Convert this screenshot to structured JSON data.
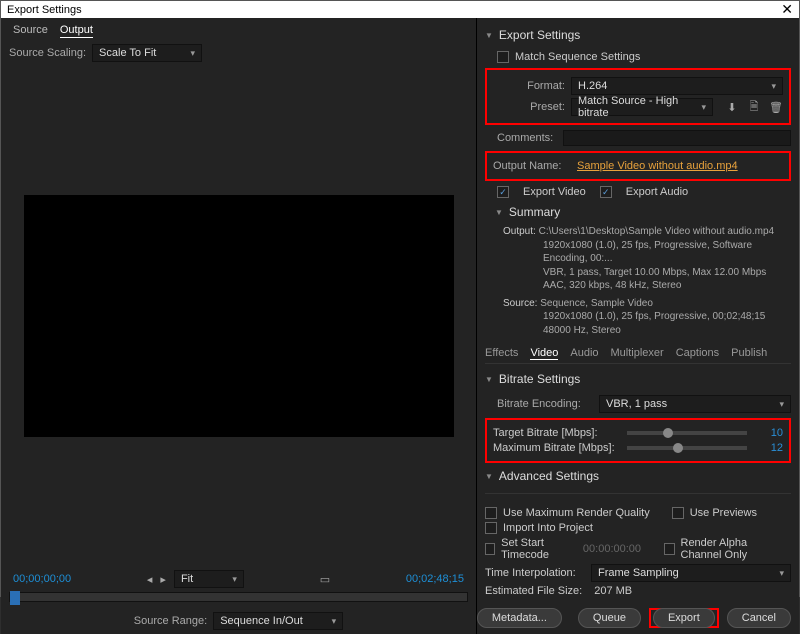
{
  "window": {
    "title": "Export Settings"
  },
  "left": {
    "tabs": {
      "source": "Source",
      "output": "Output"
    },
    "sourceScaling": {
      "label": "Source Scaling:",
      "value": "Scale To Fit"
    },
    "timeStart": "00;00;00;00",
    "timeEnd": "00;02;48;15",
    "fit": "Fit",
    "sourceRange": {
      "label": "Source Range:",
      "value": "Sequence In/Out"
    }
  },
  "right": {
    "headerExport": "Export Settings",
    "matchSequence": "Match Sequence Settings",
    "format": {
      "label": "Format:",
      "value": "H.264"
    },
    "preset": {
      "label": "Preset:",
      "value": "Match Source - High bitrate"
    },
    "comments": "Comments:",
    "outputName": {
      "label": "Output Name:",
      "value": "Sample  Video without audio.mp4"
    },
    "exportVideo": "Export Video",
    "exportAudio": "Export Audio",
    "summaryHeader": "Summary",
    "summary": {
      "outputLabel": "Output:",
      "output1": "C:\\Users\\1\\Desktop\\Sample  Video without audio.mp4",
      "output2": "1920x1080 (1.0), 25 fps, Progressive, Software Encoding, 00:...",
      "output3": "VBR, 1 pass, Target 10.00 Mbps, Max 12.00 Mbps",
      "output4": "AAC, 320 kbps, 48 kHz, Stereo",
      "sourceLabel": "Source:",
      "source1": "Sequence, Sample Video",
      "source2": "1920x1080 (1.0), 25 fps, Progressive, 00;02;48;15",
      "source3": "48000 Hz, Stereo"
    },
    "tabs2": {
      "effects": "Effects",
      "video": "Video",
      "audio": "Audio",
      "multiplexer": "Multiplexer",
      "captions": "Captions",
      "publish": "Publish"
    },
    "bitrateHeader": "Bitrate Settings",
    "bitrateEncoding": {
      "label": "Bitrate Encoding:",
      "value": "VBR, 1 pass"
    },
    "targetBitrate": {
      "label": "Target Bitrate [Mbps]:",
      "value": "10"
    },
    "maxBitrate": {
      "label": "Maximum Bitrate [Mbps]:",
      "value": "12"
    },
    "advHeader": "Advanced Settings",
    "useMaxRender": "Use Maximum Render Quality",
    "usePreviews": "Use Previews",
    "importInto": "Import Into Project",
    "setStartTC": {
      "label": "Set Start Timecode",
      "value": "00:00:00:00"
    },
    "renderAlpha": "Render Alpha Channel Only",
    "timeInterp": {
      "label": "Time Interpolation:",
      "value": "Frame Sampling"
    },
    "estSize": {
      "label": "Estimated File Size:",
      "value": "207 MB"
    },
    "buttons": {
      "metadata": "Metadata...",
      "queue": "Queue",
      "export": "Export",
      "cancel": "Cancel"
    }
  }
}
